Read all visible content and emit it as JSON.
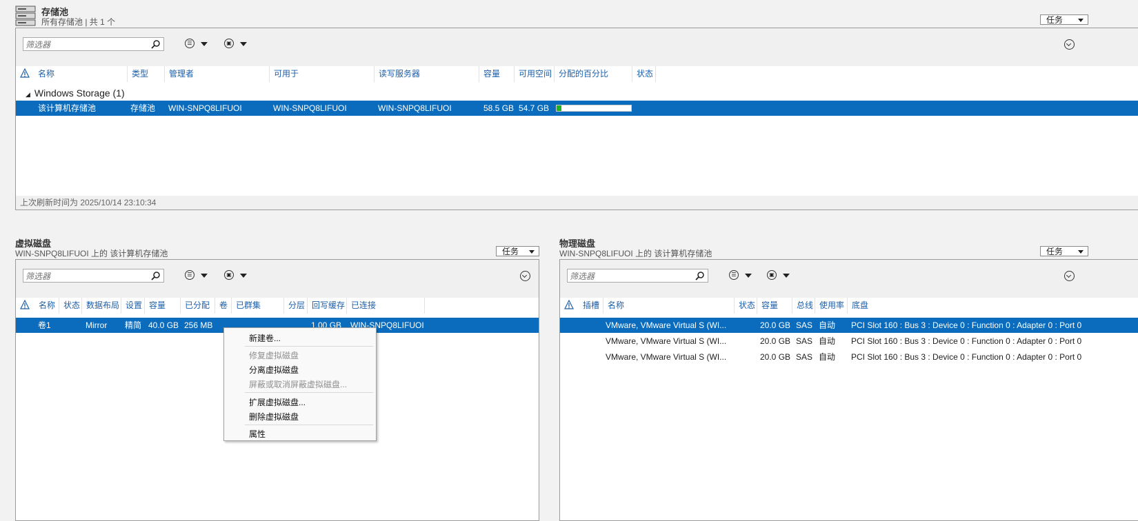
{
  "pool": {
    "title": "存储池",
    "subtitle": "所有存储池 | 共 1 个",
    "tasks_label": "任务",
    "filter_placeholder": "筛选器",
    "columns": [
      "名称",
      "类型",
      "管理者",
      "可用于",
      "读写服务器",
      "容量",
      "可用空间",
      "分配的百分比",
      "状态"
    ],
    "group_label": "Windows Storage (1)",
    "row": {
      "name": "该计算机存储池",
      "type": "存储池",
      "managed_by": "WIN-SNPQ8LIFUOI",
      "available_to": "WIN-SNPQ8LIFUOI",
      "rw_server": "WIN-SNPQ8LIFUOI",
      "capacity": "58.5 GB",
      "free_space": "54.7 GB",
      "allocated_percent": 0.065
    },
    "status_text": "上次刷新时间为 2025/10/14 23:10:34"
  },
  "vdisk": {
    "title": "虚拟磁盘",
    "subtitle": "WIN-SNPQ8LIFUOI 上的 该计算机存储池",
    "tasks_label": "任务",
    "filter_placeholder": "筛选器",
    "columns": [
      "名称",
      "状态",
      "数据布局",
      "设置",
      "容量",
      "已分配",
      "卷",
      "已群集",
      "分层",
      "回写缓存",
      "已连接"
    ],
    "row": {
      "name": "卷1",
      "layout": "Mirror",
      "provisioning": "精简",
      "capacity": "40.0 GB",
      "allocated": "256 MB",
      "writeback": "1.00 GB",
      "attached": "WIN-SNPQ8LIFUOI"
    }
  },
  "context_menu": {
    "items": [
      {
        "label": "新建卷...",
        "enabled": true
      },
      {
        "label": "修复虚拟磁盘",
        "enabled": false
      },
      {
        "label": "分离虚拟磁盘",
        "enabled": true
      },
      {
        "label": "屏蔽或取消屏蔽虚拟磁盘...",
        "enabled": false
      },
      {
        "label": "扩展虚拟磁盘...",
        "enabled": true
      },
      {
        "label": "删除虚拟磁盘",
        "enabled": true
      },
      {
        "label": "属性",
        "enabled": true
      }
    ]
  },
  "pdisk": {
    "title": "物理磁盘",
    "subtitle": "WIN-SNPQ8LIFUOI 上的 该计算机存储池",
    "tasks_label": "任务",
    "filter_placeholder": "筛选器",
    "columns": [
      "插槽",
      "名称",
      "状态",
      "容量",
      "总线",
      "使用率",
      "底盘"
    ],
    "rows": [
      {
        "name": "VMware, VMware Virtual S (WI...",
        "capacity": "20.0 GB",
        "bus": "SAS",
        "usage": "自动",
        "chassis": "PCI Slot 160 : Bus 3 : Device 0 : Function 0 : Adapter 0 : Port 0"
      },
      {
        "name": "VMware, VMware Virtual S (WI...",
        "capacity": "20.0 GB",
        "bus": "SAS",
        "usage": "自动",
        "chassis": "PCI Slot 160 : Bus 3 : Device 0 : Function 0 : Adapter 0 : Port 0"
      },
      {
        "name": "VMware, VMware Virtual S (WI...",
        "capacity": "20.0 GB",
        "bus": "SAS",
        "usage": "自动",
        "chassis": "PCI Slot 160 : Bus 3 : Device 0 : Function 0 : Adapter 0 : Port 0"
      }
    ]
  },
  "colors": {
    "selection": "#0b6cbd",
    "header_text": "#1d5fa8",
    "progress_fill": "#1fb41f"
  }
}
